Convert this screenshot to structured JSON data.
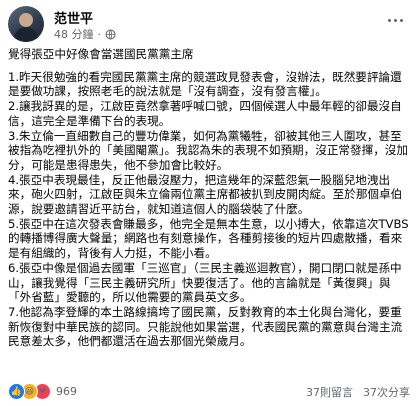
{
  "post": {
    "author": "范世平",
    "time": "48 分鐘",
    "headline": "覺得張亞中好像會當選國民黨黨主席",
    "paragraphs": [
      "1.昨天很勉強的看完國民黨黨主席的競選政見發表會，沒辦法，既然要評論還是要做功課，按照老毛的說法就是「沒有調查，沒有發言權」。",
      "2.讓我訝異的是，江啟臣竟然拿著呼喊口號，四個候選人中最年輕的卻最沒自信，這完全是準備下台的表現。",
      "3.朱立倫一直細數自己的豐功偉業，如何為黨犧牲，卻被其他三人圍攻，甚至被指為吃裡扒外的「美國閹黨」。我認為朱的表現不如預期，沒正常發揮，沒加分，可能是患得患失，他不參加會比較好。",
      "4.張亞中表現最佳，反正他最沒壓力，把這幾年的深藍怨氣一股腦兒地洩出來，砲火四射，江啟臣與朱立倫兩位黨主席都被扒到皮開肉綻。至於那個卓伯源，說要邀請習近平訪台，就知道這個人的腦袋裝了什麼。",
      "5.張亞中在這次發表會賺最多，他完全是無本生意，以小搏大，依靠這次TVBS的轉播博得廣大聲量；網路也有刻意操作，各種剪接後的短片四處散播，看來是有組織的，背後有人力挺，不能小看。",
      "6.張亞中像是個過去國軍「三巡官」（三民主義巡迴教官），開口閉口就是孫中山，讓我覺得「三民主義研究所」快要復活了。他的言論就是「黃復興」與「外省藍」愛聽的，所以他需要的黨員英文多。",
      "7.他認為李登輝的本土路線搞垮了國民黨，反對教育的本土化與台灣化，要重新恢復對中華民族的認同。只能說他如果當選，代表國民黨的黨意與台灣主流民意差太多，他們都還活在過去那個光榮歲月。"
    ],
    "reaction_count": "969",
    "comments": "37則留言",
    "shares": "37次分享"
  },
  "icons": {
    "globe": "globe-icon",
    "more": "more-options-icon",
    "like": "like-reaction-icon",
    "haha": "haha-reaction-icon",
    "love": "love-reaction-icon"
  },
  "colors": {
    "text": "#050505",
    "secondary": "#65676b",
    "like": "#1877f2",
    "haha": "#f7b125",
    "love": "#f33e58"
  }
}
